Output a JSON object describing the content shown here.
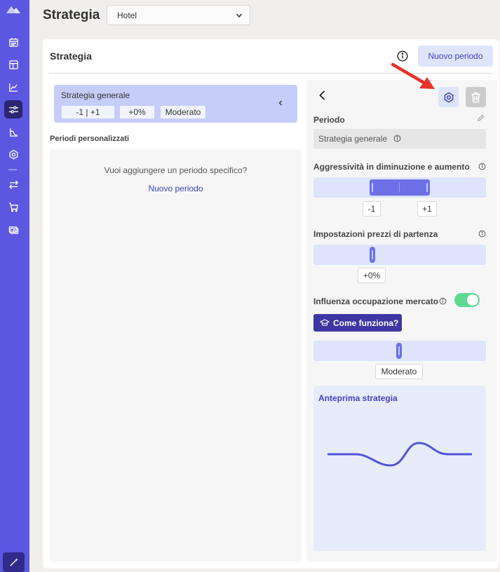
{
  "header": {
    "page_title": "Strategia",
    "hotel_select_value": "Hotel"
  },
  "sidebar": {
    "items": [
      {
        "icon": "calendar-icon"
      },
      {
        "icon": "layout-icon"
      },
      {
        "icon": "chart-icon"
      },
      {
        "icon": "sliders-icon",
        "active": true
      },
      {
        "icon": "price-chart-icon"
      },
      {
        "icon": "gear-icon"
      },
      {
        "icon": "swap-icon"
      },
      {
        "icon": "cart-icon"
      },
      {
        "icon": "money-icon"
      }
    ],
    "bottom_icon": "magic-wand-icon"
  },
  "card": {
    "title": "Strategia",
    "new_period_button": "Nuovo periodo"
  },
  "strategy_summary": {
    "name": "Strategia generale",
    "chips": [
      "-1 | +1",
      "+0%",
      "Moderato"
    ]
  },
  "custom_periods": {
    "title": "Periodi personalizzati",
    "empty_question": "Vuoi aggiungere un periodo specifico?",
    "empty_link": "Nuovo periodo"
  },
  "panel": {
    "period_label": "Periodo",
    "period_value": "Strategia generale",
    "aggressiveness_label": "Aggressività in diminuzione e aumento",
    "aggressiveness_min": "-1",
    "aggressiveness_max": "+1",
    "start_price_label": "Impostazioni prezzi di partenza",
    "start_price_value": "+0%",
    "market_influence_label": "Influenza occupazione mercato",
    "market_influence_enabled": true,
    "how_it_works_button": "Come funziona?",
    "market_influence_value": "Moderato",
    "preview_title": "Anteprima strategia"
  },
  "colors": {
    "sidebar": "#5b57e0",
    "accent": "#4143c4",
    "slider": "#6c6fe6",
    "toggle_on": "#5fd991",
    "annotation_arrow": "#e63228"
  }
}
